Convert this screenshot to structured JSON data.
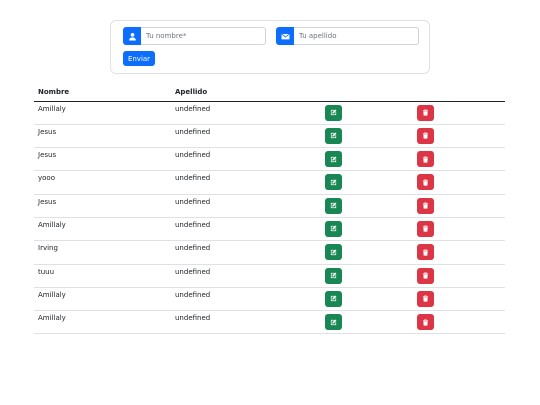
{
  "form": {
    "first_name_placeholder": "Tu nombre*",
    "last_name_placeholder": "Tu apellido",
    "first_name_value": "",
    "last_name_value": "",
    "user_icon": "user-icon",
    "email_icon": "envelope-icon",
    "submit_label": "Enviar"
  },
  "table": {
    "headers": {
      "nombre": "Nombre",
      "apellido": "Apellido"
    },
    "rows": [
      {
        "nombre": "Amillaly",
        "apellido": "undefined"
      },
      {
        "nombre": "Jesus",
        "apellido": "undefined"
      },
      {
        "nombre": "Jesus",
        "apellido": "undefined"
      },
      {
        "nombre": "yooo",
        "apellido": "undefined"
      },
      {
        "nombre": "Jesus",
        "apellido": "undefined"
      },
      {
        "nombre": "Amillaly",
        "apellido": "undefined"
      },
      {
        "nombre": "Irving",
        "apellido": "undefined"
      },
      {
        "nombre": "tuuu",
        "apellido": "undefined"
      },
      {
        "nombre": "Amillaly",
        "apellido": "undefined"
      },
      {
        "nombre": "Amillaly",
        "apellido": "undefined"
      }
    ],
    "edit_icon": "edit-icon",
    "delete_icon": "trash-icon"
  },
  "colors": {
    "primary": "#0d6efd",
    "success": "#198754",
    "danger": "#dc3545"
  }
}
